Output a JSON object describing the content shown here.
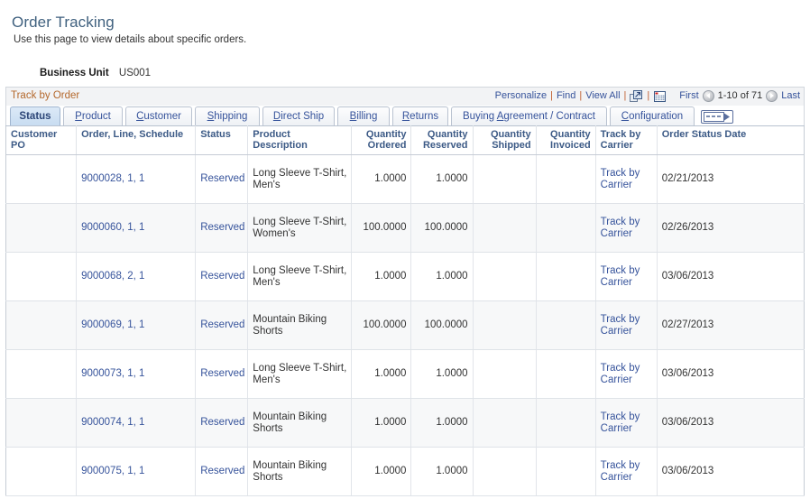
{
  "page": {
    "title": "Order Tracking",
    "subtitle": "Use this page to view details about specific orders.",
    "business_unit_label": "Business Unit",
    "business_unit_value": "US001"
  },
  "grid": {
    "title": "Track by Order",
    "toolbar": {
      "personalize": "Personalize",
      "find": "Find",
      "view_all": "View All",
      "separator": "|",
      "expand_icon": "new-window-icon",
      "download_icon": "download-to-excel-icon"
    },
    "navigation": {
      "first": "First",
      "range": "1-10 of 71",
      "last": "Last",
      "prev_icon": "previous-page-arrow-icon",
      "next_icon": "next-page-arrow-icon"
    },
    "tabs": [
      {
        "label": "Status",
        "accel": "S",
        "active": true
      },
      {
        "label": "Product",
        "accel": "P",
        "active": false
      },
      {
        "label": "Customer",
        "accel": "C",
        "active": false
      },
      {
        "label": "Shipping",
        "accel": "S",
        "active": false
      },
      {
        "label": "Direct Ship",
        "accel": "D",
        "active": false
      },
      {
        "label": "Billing",
        "accel": "B",
        "active": false
      },
      {
        "label": "Returns",
        "accel": "R",
        "active": false
      },
      {
        "label": "Buying Agreement / Contract",
        "accel": "A",
        "active": false
      },
      {
        "label": "Configuration",
        "accel": "C",
        "active": false
      }
    ],
    "tab_next_icon": "show-next-tabs-icon",
    "columns": [
      {
        "label": "Customer PO",
        "align": "left"
      },
      {
        "label": "Order, Line, Schedule",
        "align": "left"
      },
      {
        "label": "Status",
        "align": "left"
      },
      {
        "label": "Product Description",
        "align": "left"
      },
      {
        "label": "Quantity Ordered",
        "align": "right"
      },
      {
        "label": "Quantity Reserved",
        "align": "right"
      },
      {
        "label": "Quantity Shipped",
        "align": "right"
      },
      {
        "label": "Quantity Invoiced",
        "align": "right"
      },
      {
        "label": "Track by Carrier",
        "align": "left"
      },
      {
        "label": "Order Status Date",
        "align": "left"
      }
    ],
    "rows": [
      {
        "customer_po": "",
        "order_line_schedule": "9000028, 1, 1",
        "status": "Reserved",
        "product_description": "Long Sleeve T-Shirt, Men's",
        "qty_ordered": "1.0000",
        "qty_reserved": "1.0000",
        "qty_shipped": "",
        "qty_invoiced": "",
        "track_by_carrier": "Track by Carrier",
        "order_status_date": "02/21/2013"
      },
      {
        "customer_po": "",
        "order_line_schedule": "9000060, 1, 1",
        "status": "Reserved",
        "product_description": "Long Sleeve T-Shirt, Women's",
        "qty_ordered": "100.0000",
        "qty_reserved": "100.0000",
        "qty_shipped": "",
        "qty_invoiced": "",
        "track_by_carrier": "Track by Carrier",
        "order_status_date": "02/26/2013"
      },
      {
        "customer_po": "",
        "order_line_schedule": "9000068, 2, 1",
        "status": "Reserved",
        "product_description": "Long Sleeve T-Shirt, Men's",
        "qty_ordered": "1.0000",
        "qty_reserved": "1.0000",
        "qty_shipped": "",
        "qty_invoiced": "",
        "track_by_carrier": "Track by Carrier",
        "order_status_date": "03/06/2013"
      },
      {
        "customer_po": "",
        "order_line_schedule": "9000069, 1, 1",
        "status": "Reserved",
        "product_description": "Mountain Biking Shorts",
        "qty_ordered": "100.0000",
        "qty_reserved": "100.0000",
        "qty_shipped": "",
        "qty_invoiced": "",
        "track_by_carrier": "Track by Carrier",
        "order_status_date": "02/27/2013"
      },
      {
        "customer_po": "",
        "order_line_schedule": "9000073, 1, 1",
        "status": "Reserved",
        "product_description": "Long Sleeve T-Shirt, Men's",
        "qty_ordered": "1.0000",
        "qty_reserved": "1.0000",
        "qty_shipped": "",
        "qty_invoiced": "",
        "track_by_carrier": "Track by Carrier",
        "order_status_date": "03/06/2013"
      },
      {
        "customer_po": "",
        "order_line_schedule": "9000074, 1, 1",
        "status": "Reserved",
        "product_description": "Mountain Biking Shorts",
        "qty_ordered": "1.0000",
        "qty_reserved": "1.0000",
        "qty_shipped": "",
        "qty_invoiced": "",
        "track_by_carrier": "Track by Carrier",
        "order_status_date": "03/06/2013"
      },
      {
        "customer_po": "",
        "order_line_schedule": "9000075, 1, 1",
        "status": "Reserved",
        "product_description": "Mountain Biking Shorts",
        "qty_ordered": "1.0000",
        "qty_reserved": "1.0000",
        "qty_shipped": "",
        "qty_invoiced": "",
        "track_by_carrier": "Track by Carrier",
        "order_status_date": "03/06/2013"
      }
    ]
  },
  "colors": {
    "title_blue": "#40617f",
    "link_blue": "#36539b",
    "grid_title_orange": "#b4682c",
    "header_text": "#3c5a86",
    "alt_row": "#f7f8f9"
  }
}
